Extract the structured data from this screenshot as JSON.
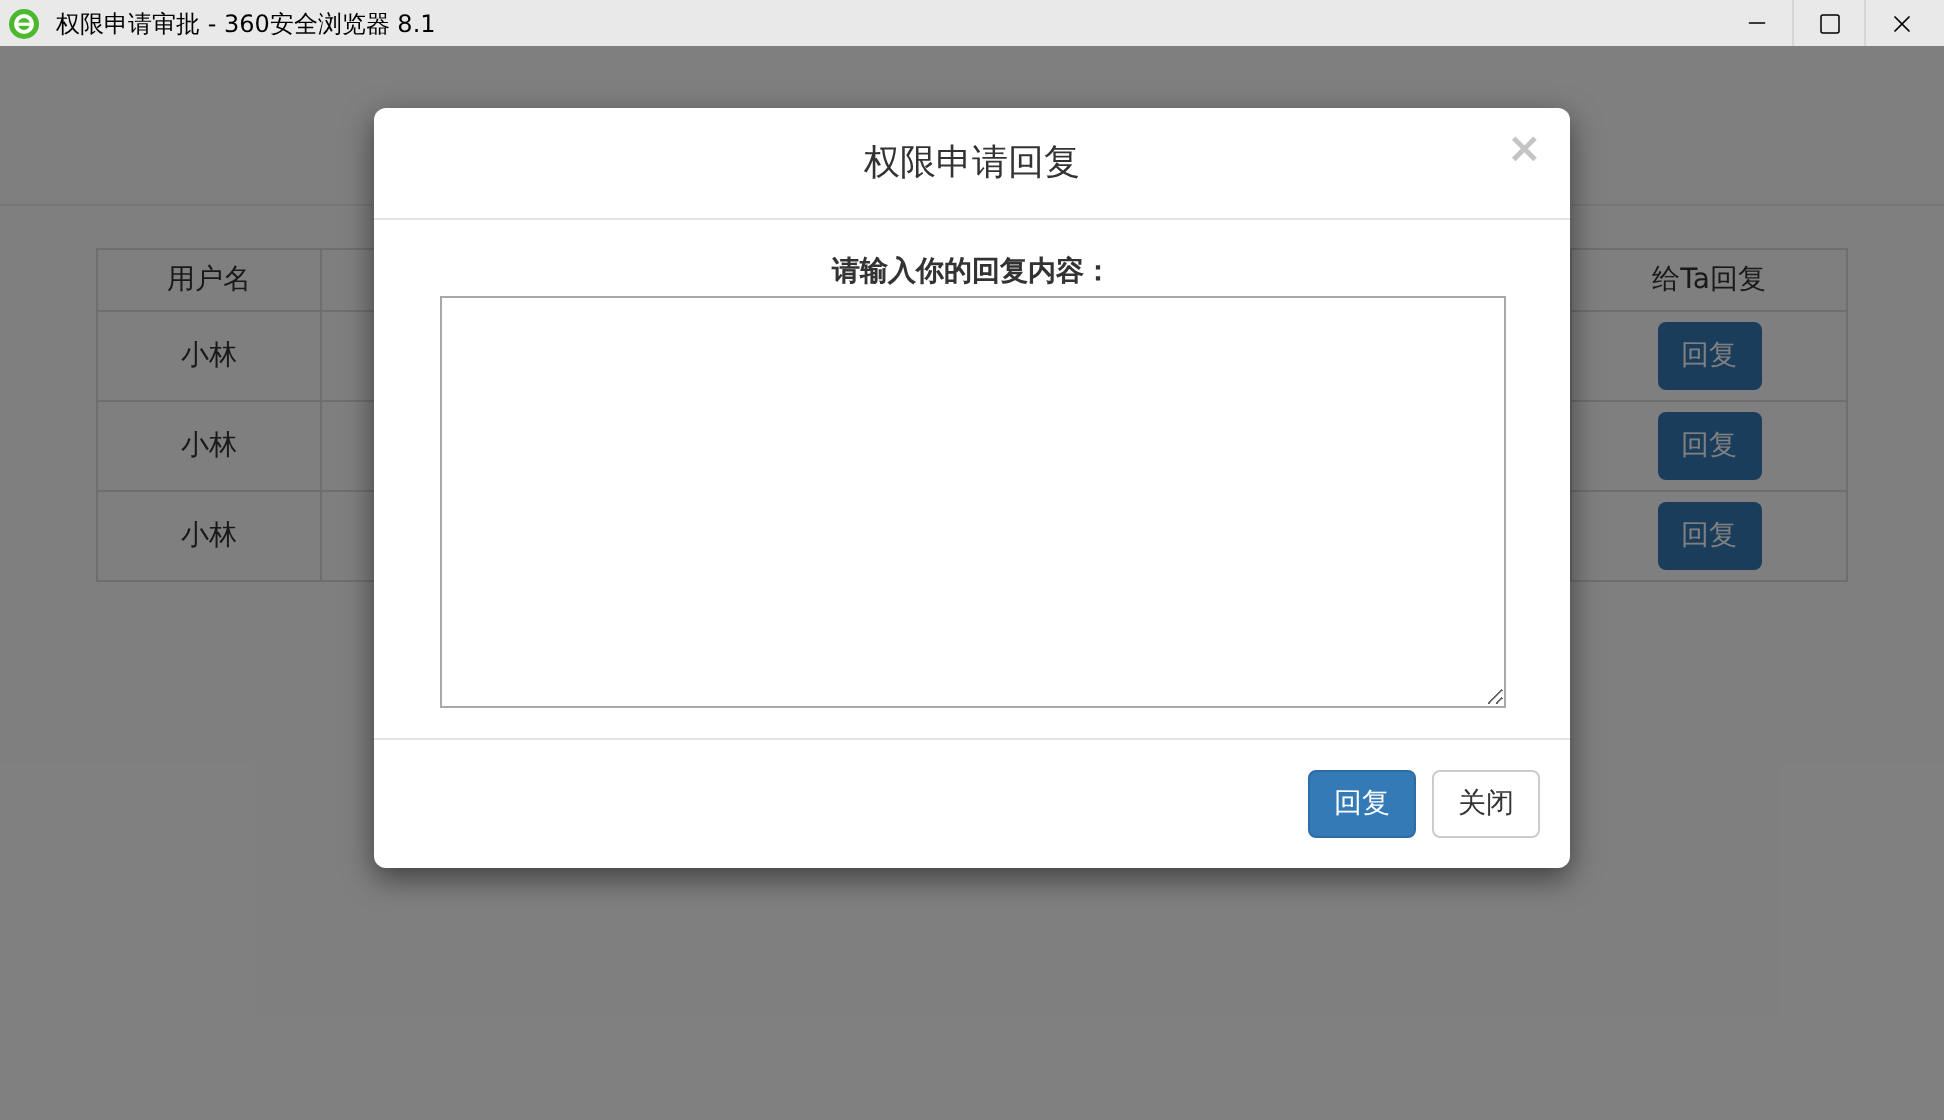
{
  "window": {
    "title": "权限申请审批 - 360安全浏览器 8.1"
  },
  "table": {
    "columns": [
      "用户名",
      "给Ta回复"
    ],
    "rows": [
      {
        "user": "小林",
        "action": "回复"
      },
      {
        "user": "小林",
        "action": "回复"
      },
      {
        "user": "小林",
        "action": "回复"
      }
    ]
  },
  "dialog": {
    "title": "权限申请回复",
    "close": "×",
    "prompt": "请输入你的回复内容：",
    "buttons": [
      {
        "label": "回复",
        "kind": "primary"
      },
      {
        "label": "关闭",
        "kind": "default"
      }
    ]
  }
}
